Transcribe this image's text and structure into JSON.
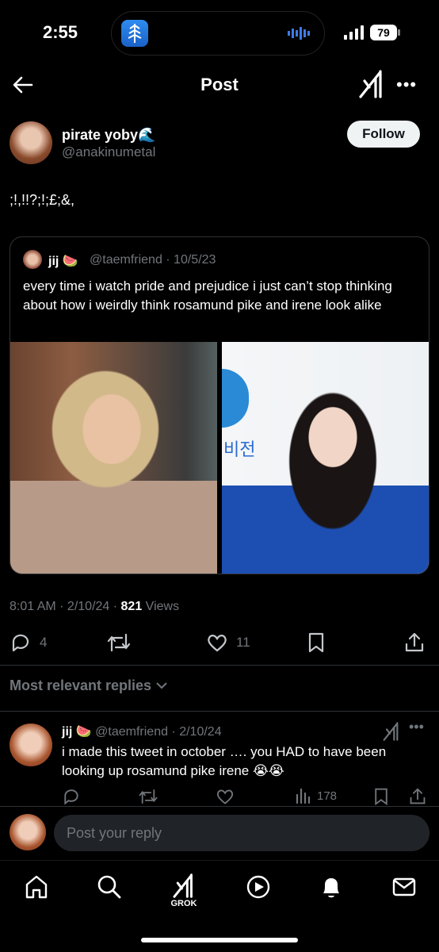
{
  "status_bar": {
    "time": "2:55",
    "battery": "79",
    "icons": [
      "app-activity-icon",
      "audio-wave-icon",
      "signal-icon",
      "battery-icon"
    ]
  },
  "header": {
    "title": "Post",
    "icons": [
      "back-arrow-icon",
      "grok-icon",
      "more-icon"
    ]
  },
  "post": {
    "author_name": "pirate yoby🌊",
    "author_handle": "@anakinumetal",
    "follow_label": "Follow",
    "text": ";!,!!?;!;£;&,",
    "quote": {
      "name": "jij 🍉",
      "handle_date": "@taemfriend · 10/5/23",
      "text": "every time i watch pride and prejudice i just can’t stop thinking about how i weirdly think rosamund pike and irene look alike",
      "image_right_text": "비전"
    },
    "meta": {
      "time_date": "8:01 AM · 2/10/24 · ",
      "views_count": "821",
      "views_label": " Views"
    },
    "actions": {
      "replies": "4",
      "reposts": "",
      "likes": "11"
    }
  },
  "replies_section": {
    "sort_label": "Most relevant replies"
  },
  "reply": {
    "name": "jij 🍉",
    "handle_date": "@taemfriend · 2/10/24",
    "text": "i made this tweet in october …. you HAD to have been looking up rosamund pike irene 😭😭",
    "views": "178"
  },
  "composer": {
    "placeholder": "Post your reply"
  },
  "tab_bar": {
    "grok_label": "GROK",
    "items": [
      "home-icon",
      "search-icon",
      "grok-icon",
      "video-icon",
      "notifications-icon",
      "messages-icon"
    ]
  },
  "colors": {
    "background": "#000000",
    "text_primary": "#e7e9ea",
    "text_secondary": "#71767b",
    "border": "#2f3336",
    "follow_bg": "#eff3f4"
  }
}
